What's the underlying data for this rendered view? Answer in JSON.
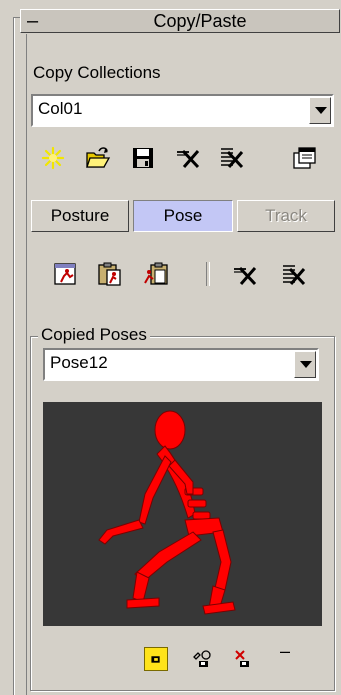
{
  "rollout": {
    "title": "Copy/Paste",
    "collapse_symbol": "–"
  },
  "copy_collections": {
    "label": "Copy Collections",
    "selected": "Col01",
    "toolbar_icons": [
      "new-collection-icon",
      "load-collection-icon",
      "save-collection-icon",
      "delete-collection-icon",
      "delete-all-collections-icon",
      "collection-properties-icon"
    ]
  },
  "modes": [
    {
      "label": "Posture",
      "state": "normal"
    },
    {
      "label": "Pose",
      "state": "active"
    },
    {
      "label": "Track",
      "state": "disabled"
    }
  ],
  "pose_toolbar_icons": [
    "copy-pose-icon",
    "paste-pose-icon",
    "paste-opposite-icon",
    "delete-selected-icon",
    "delete-all-icon"
  ],
  "copied_poses": {
    "label": "Copied Poses",
    "selected": "Pose12",
    "bottom_icons": [
      "capture-viewport-icon",
      "auto-generate-icon",
      "no-image-icon"
    ],
    "extra_symbol": "–"
  },
  "colors": {
    "panel": "#d4d0c8",
    "active_mode": "#c3c7f5",
    "viewport_bg": "#373737",
    "figure": "#ff0000",
    "selected_icon": "#ffe31a"
  }
}
